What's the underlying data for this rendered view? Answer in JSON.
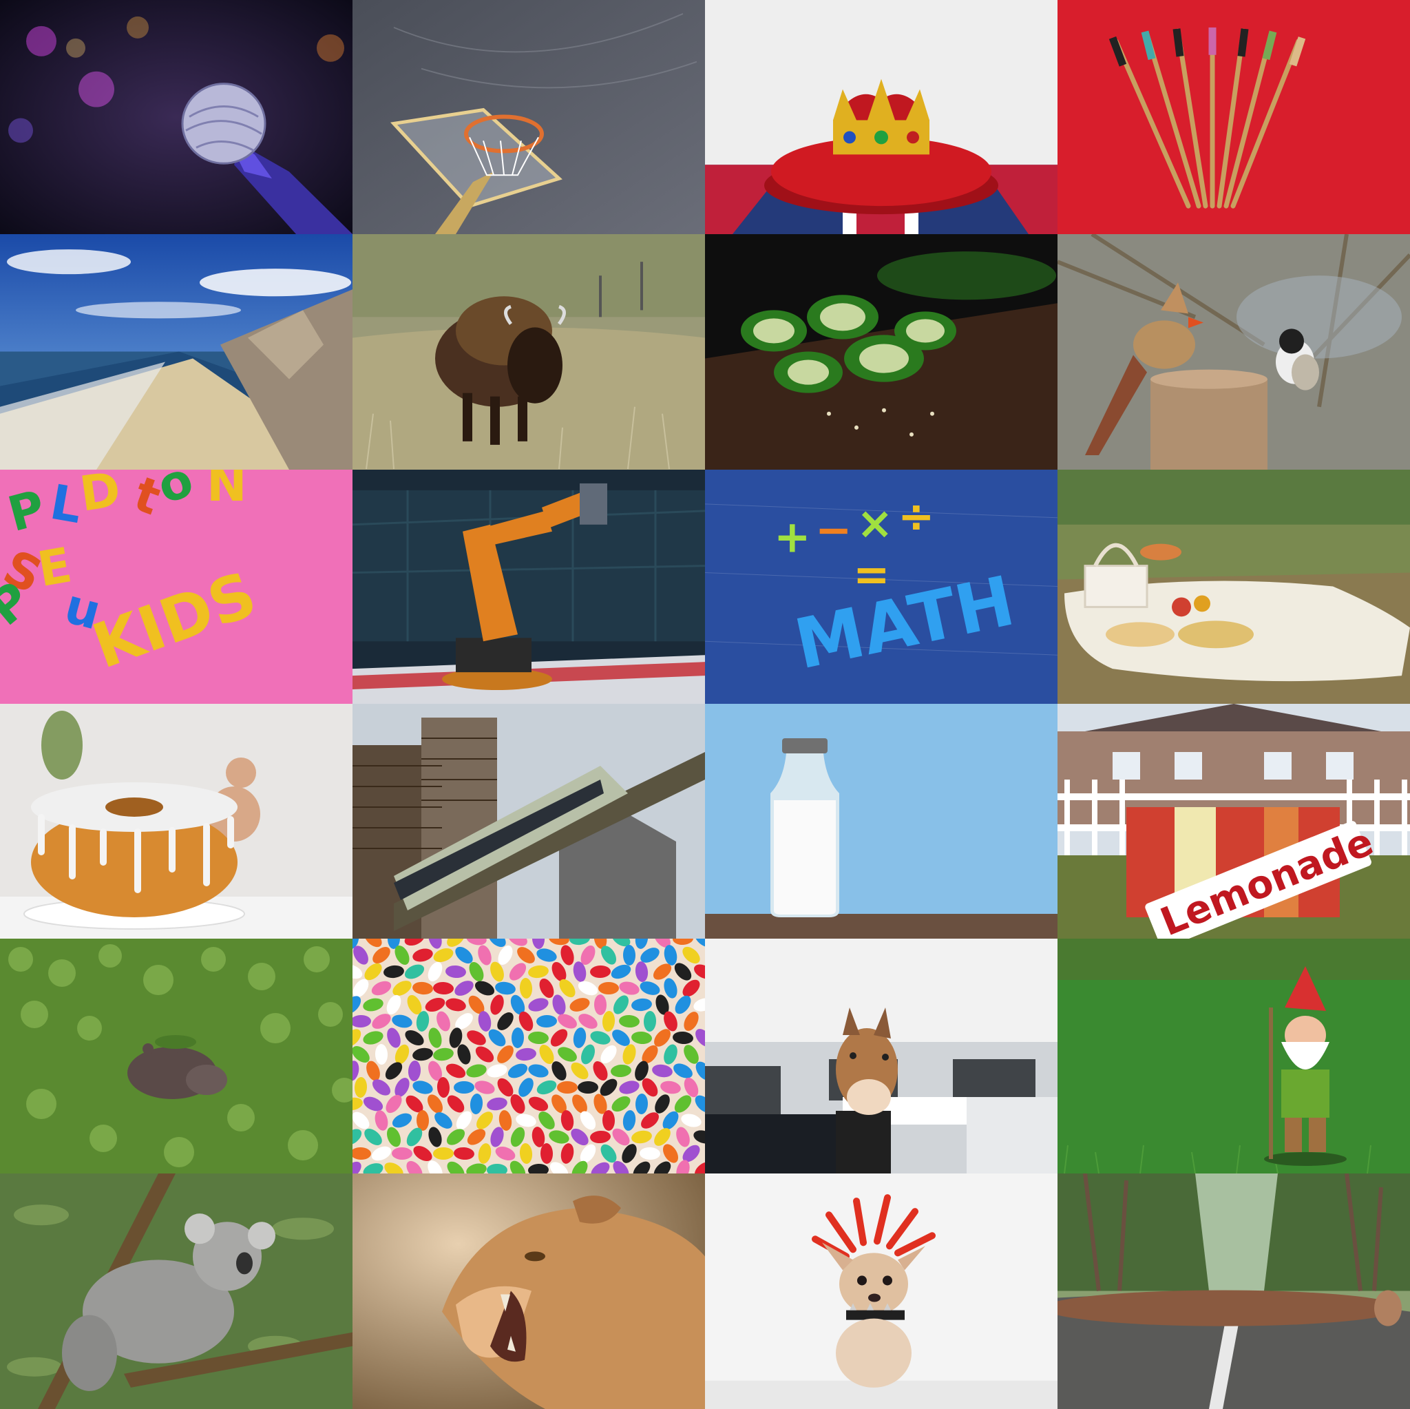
{
  "grid": {
    "rows": 6,
    "cols": 4,
    "background": "#111111"
  },
  "tiles": [
    {
      "id": "microphone",
      "subject": "microphone-icon",
      "text": ""
    },
    {
      "id": "basketball-hoop",
      "subject": "basketball-hoop-icon",
      "text": ""
    },
    {
      "id": "crown",
      "subject": "crown-icon",
      "text": ""
    },
    {
      "id": "toothbrushes",
      "subject": "toothbrush-icon",
      "text": ""
    },
    {
      "id": "beach",
      "subject": "beach-icon",
      "text": ""
    },
    {
      "id": "bison",
      "subject": "bison-icon",
      "text": ""
    },
    {
      "id": "jalapenos",
      "subject": "pepper-icon",
      "text": ""
    },
    {
      "id": "birds",
      "subject": "bird-icon",
      "text": ""
    },
    {
      "id": "kids-letters",
      "subject": "letters-icon",
      "text": "KIDS"
    },
    {
      "id": "robot-arm",
      "subject": "robot-arm-icon",
      "text": ""
    },
    {
      "id": "math-letters",
      "subject": "math-icon",
      "text": "MATH"
    },
    {
      "id": "picnic",
      "subject": "picnic-basket-icon",
      "text": ""
    },
    {
      "id": "bundt-cake",
      "subject": "cake-icon",
      "text": ""
    },
    {
      "id": "monorail",
      "subject": "train-icon",
      "text": ""
    },
    {
      "id": "milk-bottle",
      "subject": "bottle-icon",
      "text": ""
    },
    {
      "id": "lemonade-stand",
      "subject": "stand-icon",
      "text": "Lemonade"
    },
    {
      "id": "hippo",
      "subject": "hippo-icon",
      "text": ""
    },
    {
      "id": "jelly-beans",
      "subject": "candy-icon",
      "text": ""
    },
    {
      "id": "horse-mask",
      "subject": "horse-mask-icon",
      "text": ""
    },
    {
      "id": "gnome",
      "subject": "gnome-icon",
      "text": ""
    },
    {
      "id": "koala",
      "subject": "koala-icon",
      "text": ""
    },
    {
      "id": "lioness",
      "subject": "lioness-icon",
      "text": ""
    },
    {
      "id": "punk-chihuahua",
      "subject": "dog-icon",
      "text": ""
    },
    {
      "id": "fallen-tree",
      "subject": "log-icon",
      "text": ""
    }
  ]
}
